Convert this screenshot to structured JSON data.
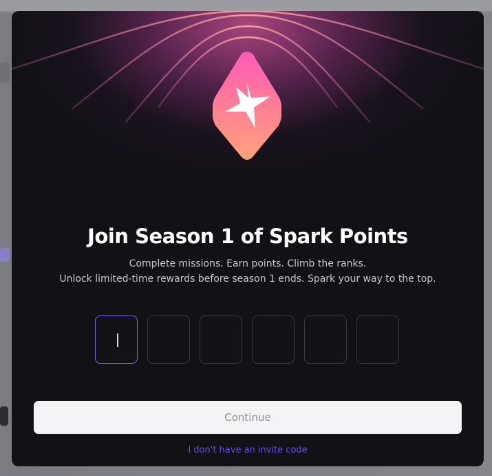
{
  "modal": {
    "title": "Join Season 1 of Spark Points",
    "subtitle_line1": "Complete missions. Earn points. Climb the ranks.",
    "subtitle_line2": "Unlock limited-time rewards before season 1 ends. Spark your way to the top.",
    "invite_code": {
      "length": 6,
      "values": [
        "",
        "",
        "",
        "",
        "",
        ""
      ],
      "active_index": 0
    },
    "continue_label": "Continue",
    "no_code_link": "I don't have an invite code",
    "badge_icon": "spark-star-icon"
  },
  "colors": {
    "modal_bg": "#111116",
    "accent": "#7b6cf0",
    "link": "#6b4ee6",
    "badge_top": "#ff5ab4",
    "badge_bottom": "#ffa27a"
  }
}
